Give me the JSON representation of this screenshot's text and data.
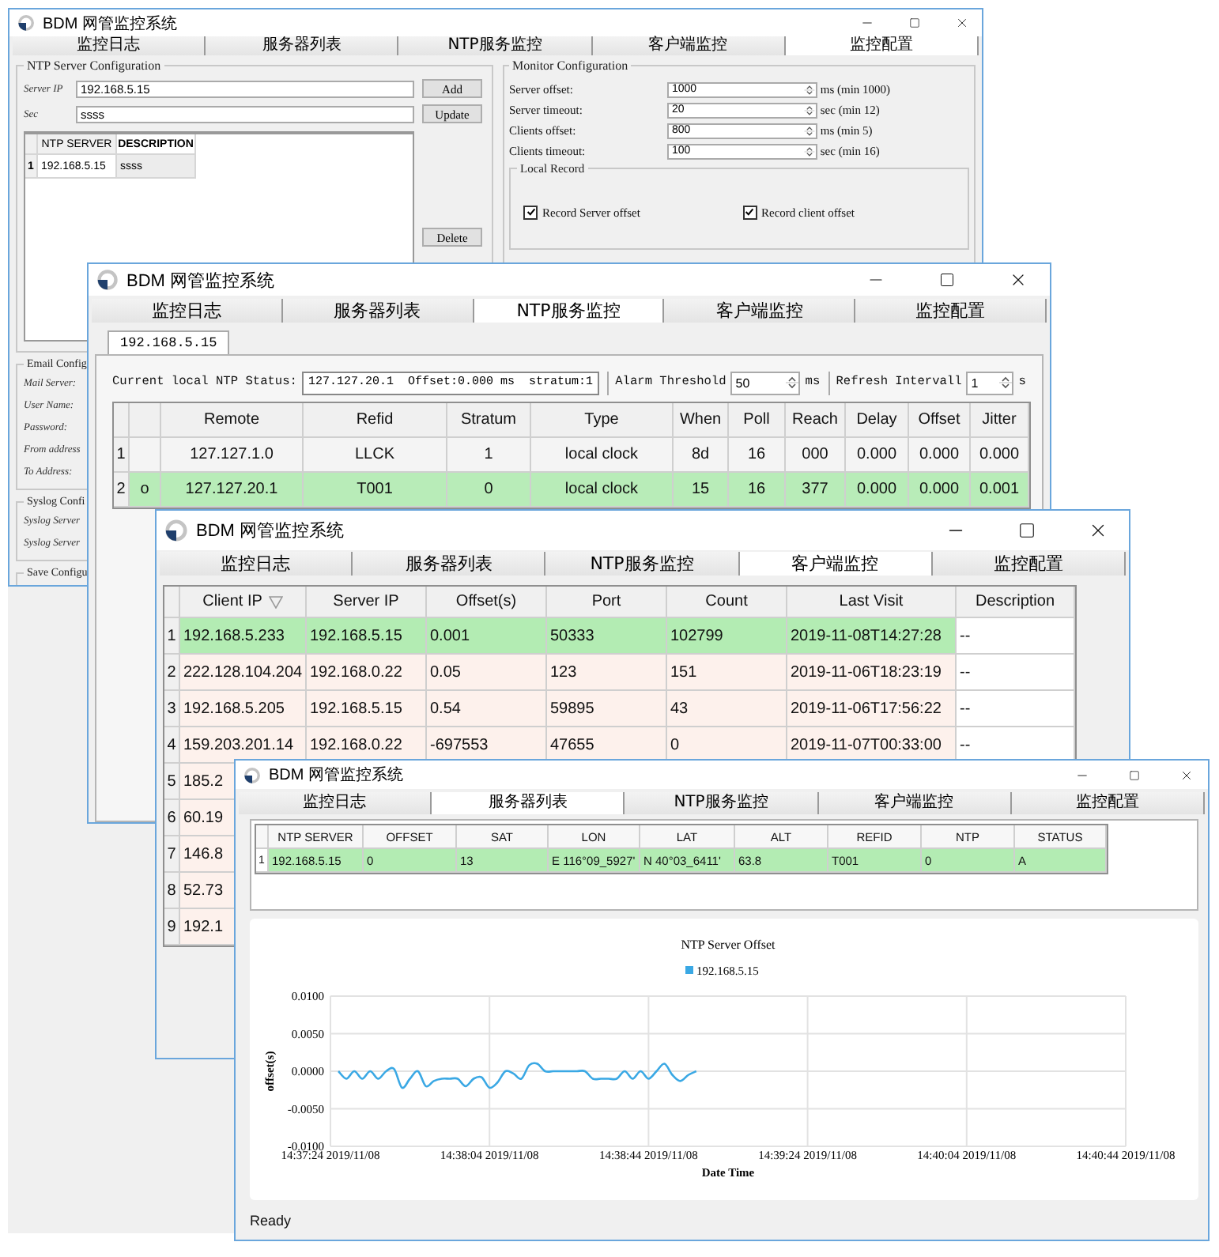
{
  "windows": [
    {
      "kind": "config",
      "title": "BDM 网管监控系统",
      "tabs": [
        {
          "label": "监控日志",
          "selected": false
        },
        {
          "label": "服务器列表",
          "selected": false
        },
        {
          "label": "NTP服务监控",
          "selected": false
        },
        {
          "label": "客户端监控",
          "selected": false
        },
        {
          "label": "监控配置",
          "selected": true
        }
      ],
      "ntp_server_config": {
        "title": "NTP Server Configuration",
        "fields": [
          {
            "label": "Server IP",
            "value": "192.168.5.15"
          },
          {
            "label": "Sec",
            "value": "ssss"
          }
        ],
        "buttons": [
          "Add",
          "Update",
          "Delete"
        ],
        "table": {
          "columns": [
            {
              "label": "NTP SERVER",
              "selected": false
            },
            {
              "label": "DESCRIPTION",
              "selected": true
            }
          ],
          "rows": [
            {
              "number": "1",
              "cells": [
                "192.168.5.15",
                "ssss"
              ]
            }
          ]
        }
      },
      "monitor_config": {
        "title": "Monitor Configuration",
        "fields": [
          {
            "label": "Server offset:",
            "value": "1000",
            "unit": "ms (min 1000)"
          },
          {
            "label": "Server timeout:",
            "value": "20",
            "unit": "sec (min 12)"
          },
          {
            "label": "Clients offset:",
            "value": "800",
            "unit": "ms (min 5)"
          },
          {
            "label": "Clients timeout:",
            "value": "100",
            "unit": "sec (min 16)"
          }
        ],
        "local_record": {
          "title": "Local Record",
          "checkboxes": [
            {
              "label": "Record Server offset",
              "checked": true
            },
            {
              "label": "Record client offset",
              "checked": true
            }
          ]
        }
      },
      "email_config": {
        "title": "Email Config",
        "labels": [
          "Mail Server:",
          "User Name:",
          "Password:",
          "From address",
          "To Address:"
        ]
      },
      "syslog_config": {
        "title": "Syslog Confi",
        "labels": [
          "Syslog Server",
          "Syslog Server"
        ]
      },
      "save_config": {
        "title": "Save Configu"
      }
    },
    {
      "kind": "ntp",
      "title": "BDM 网管监控系统",
      "tabs": [
        {
          "label": "监控日志",
          "selected": false
        },
        {
          "label": "服务器列表",
          "selected": false
        },
        {
          "label": "NTP服务监控",
          "selected": true
        },
        {
          "label": "客户端监控",
          "selected": false
        },
        {
          "label": "监控配置",
          "selected": false
        }
      ],
      "subtabs": [
        {
          "label": "192.168.5.15",
          "selected": true
        }
      ],
      "status": {
        "label": "Current local NTP Status:",
        "value": "127.127.20.1  Offset:0.000 ms  stratum:1"
      },
      "alarm": {
        "label": "Alarm Threshold",
        "value": "50",
        "unit": "ms"
      },
      "refresh": {
        "label": "Refresh Intervall",
        "value": "1",
        "unit": "s"
      },
      "table": {
        "columns": [
          "Remote",
          "Refid",
          "Stratum",
          "Type",
          "When",
          "Poll",
          "Reach",
          "Delay",
          "Offset",
          "Jitter"
        ],
        "rows": [
          {
            "number": "1",
            "highlighted": false,
            "cells": [
              "127.127.1.0",
              "LLCK",
              "1",
              "local clock",
              "8d",
              "16",
              "000",
              "0.000",
              "0.000",
              "0.000"
            ]
          },
          {
            "number": "2",
            "highlighted": true,
            "marker": "o",
            "cells": [
              "127.127.20.1",
              "T001",
              "0",
              "local clock",
              "15",
              "16",
              "377",
              "0.000",
              "0.000",
              "0.001"
            ]
          }
        ]
      }
    },
    {
      "kind": "clients",
      "title": "BDM 网管监控系统",
      "tabs": [
        {
          "label": "监控日志",
          "selected": false
        },
        {
          "label": "服务器列表",
          "selected": false
        },
        {
          "label": "NTP服务监控",
          "selected": false
        },
        {
          "label": "客户端监控",
          "selected": true
        },
        {
          "label": "监控配置",
          "selected": false
        }
      ],
      "table": {
        "columns": [
          {
            "label": "Client IP",
            "sorted": true
          },
          {
            "label": "Server IP",
            "sorted": false
          },
          {
            "label": "Offset(s)",
            "sorted": false
          },
          {
            "label": "Port",
            "sorted": false
          },
          {
            "label": "Count",
            "sorted": false
          },
          {
            "label": "Last Visit",
            "sorted": false
          },
          {
            "label": "Description",
            "sorted": false
          }
        ],
        "rows": [
          {
            "number": "1",
            "highlighted": true,
            "cells": [
              "192.168.5.233",
              "192.168.5.15",
              "0.001",
              "50333",
              "102799",
              "2019-11-08T14:27:28",
              "--"
            ]
          },
          {
            "number": "2",
            "highlighted": false,
            "cells": [
              "222.128.104.204",
              "192.168.0.22",
              "0.05",
              "123",
              "151",
              "2019-11-06T18:23:19",
              "--"
            ]
          },
          {
            "number": "3",
            "highlighted": false,
            "cells": [
              "192.168.5.205",
              "192.168.5.15",
              "0.54",
              "59895",
              "43",
              "2019-11-06T17:56:22",
              "--"
            ]
          },
          {
            "number": "4",
            "highlighted": false,
            "cells": [
              "159.203.201.14",
              "192.168.0.22",
              "-697553",
              "47655",
              "0",
              "2019-11-07T00:33:00",
              "--"
            ]
          },
          {
            "number": "5",
            "highlighted": false,
            "cells": [
              "185.2"
            ]
          },
          {
            "number": "6",
            "highlighted": false,
            "cells": [
              "60.19"
            ]
          },
          {
            "number": "7",
            "highlighted": false,
            "cells": [
              "146.8"
            ]
          },
          {
            "number": "8",
            "highlighted": false,
            "cells": [
              "52.73"
            ]
          },
          {
            "number": "9",
            "highlighted": false,
            "cells": [
              "192.1"
            ]
          }
        ]
      }
    },
    {
      "kind": "servers",
      "title": "BDM 网管监控系统",
      "tabs": [
        {
          "label": "监控日志",
          "selected": false
        },
        {
          "label": "服务器列表",
          "selected": true
        },
        {
          "label": "NTP服务监控",
          "selected": false
        },
        {
          "label": "客户端监控",
          "selected": false
        },
        {
          "label": "监控配置",
          "selected": false
        }
      ],
      "table": {
        "columns": [
          "NTP SERVER",
          "OFFSET",
          "SAT",
          "LON",
          "LAT",
          "ALT",
          "REFID",
          "NTP",
          "STATUS"
        ],
        "rows": [
          {
            "number": "1",
            "highlighted": true,
            "cells": [
              "192.168.5.15",
              "0",
              "13",
              "E 116°09_5927'",
              "N 40°03_6411'",
              "63.8",
              "T001",
              "0",
              "A"
            ]
          }
        ]
      },
      "chart": {
        "chart_data": {
          "type": "line",
          "title": "NTP Server Offset",
          "xlabel": "Date Time",
          "ylabel": "offset(s)",
          "categories": [
            "14:37:24 2019/11/08",
            null,
            null,
            null,
            null,
            null,
            null,
            null,
            null,
            null,
            null,
            null,
            null,
            null,
            null,
            null,
            null,
            null,
            null,
            null,
            "14:38:04 2019/11/08",
            null,
            null,
            null,
            null,
            null,
            null,
            null,
            null,
            null,
            null,
            null,
            null,
            null,
            null,
            null,
            null,
            null,
            null,
            null,
            "14:38:44 2019/11/08",
            null,
            null,
            null,
            null,
            null,
            null,
            null,
            null,
            null,
            null,
            null,
            null,
            null,
            null,
            null,
            null,
            null,
            null,
            null,
            "14:39:24 2019/11/08",
            null,
            null,
            null,
            null,
            null,
            null,
            null,
            null,
            null,
            null,
            null,
            null,
            null,
            null,
            null,
            null,
            null,
            null,
            null,
            "14:40:04 2019/11/08",
            null,
            null,
            null,
            null,
            null,
            null,
            null,
            null,
            null,
            null,
            null,
            null,
            null,
            null,
            null,
            null,
            null,
            null,
            null,
            "14:40:44 2019/11/08"
          ],
          "series": [
            {
              "name": "192.168.5.15",
              "color": "#3aa8e4",
              "values": [
                null,
                0,
                -0.001,
                0,
                -0.001,
                0,
                -0.001,
                0,
                0.0003,
                -0.0022,
                -0.001,
                0,
                -0.002,
                -0.0013,
                -0.001,
                -0.001,
                -0.001,
                -0.002,
                -0.001,
                -0.0008,
                -0.0022,
                -0.0015,
                0,
                -0.0003,
                -0.001,
                0.0008,
                0.001,
                0,
                0,
                0,
                0,
                0,
                0,
                -0.001,
                -0.001,
                -0.001,
                -0.001,
                0,
                -0.001,
                0,
                -0.001,
                0,
                0.001,
                -0.0005,
                -0.0013,
                -0.0005,
                0,
                null,
                null,
                null,
                null,
                null,
                null,
                null,
                null,
                null,
                null,
                null,
                null,
                null,
                null,
                null,
                null,
                null,
                null,
                null,
                null,
                null,
                null,
                null,
                null,
                null,
                null,
                null,
                null,
                null,
                null,
                null,
                null,
                null,
                null,
                null,
                null,
                null,
                null,
                null,
                null,
                null,
                null,
                null,
                null,
                null,
                null,
                null,
                null,
                null,
                null,
                null,
                null,
                null,
                null
              ]
            }
          ],
          "grid": true,
          "ylim": [
            -0.01,
            0.01
          ],
          "yticks": [
            {
              "value": 0.01,
              "label": "0.0100"
            },
            {
              "value": 0.005,
              "label": "0.0050"
            },
            {
              "value": 0,
              "label": "0.0000"
            },
            {
              "value": -0.005,
              "label": "-0.0050"
            },
            {
              "value": -0.01,
              "label": "-0.0100"
            }
          ]
        }
      },
      "status_bar": "Ready"
    }
  ]
}
